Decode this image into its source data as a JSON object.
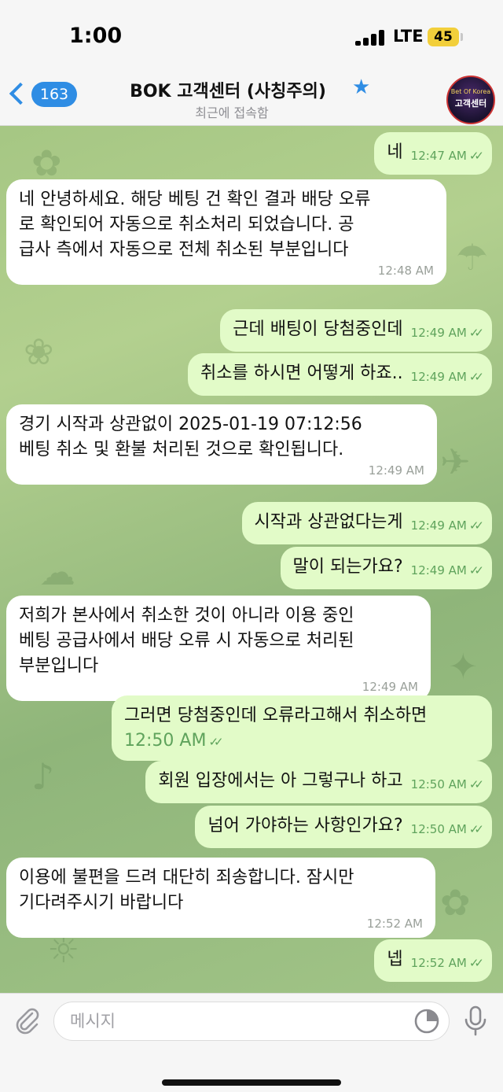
{
  "status_bar": {
    "time": "1:00",
    "network": "LTE",
    "battery": "45"
  },
  "header": {
    "back_count": "163",
    "title": "BOK 고객센터 (사칭주의)",
    "subtitle": "최근에 접속함",
    "avatar_text_top": "Bet Of Korea",
    "avatar_text_main": "고객센터"
  },
  "messages": [
    {
      "dir": "out",
      "text": "네",
      "time": "12:47 AM"
    },
    {
      "dir": "in",
      "text": "네 안녕하세요. 해당 베팅 건 확인 결과 배당 오류\n로 확인되어 자동으로 취소처리 되었습니다. 공\n급사 측에서 자동으로 전체 취소된 부분입니다",
      "time": "12:48 AM"
    },
    {
      "dir": "out",
      "text": "근데 배팅이 당첨중인데",
      "time": "12:49 AM"
    },
    {
      "dir": "out",
      "text": "취소를 하시면 어떻게 하죠..",
      "time": "12:49 AM"
    },
    {
      "dir": "in",
      "text": "경기 시작과 상관없이 2025-01-19 07:12:56\n베팅 취소 및 환불 처리된 것으로 확인됩니다.",
      "time": "12:49 AM"
    },
    {
      "dir": "out",
      "text": "시작과 상관없다는게",
      "time": "12:49 AM"
    },
    {
      "dir": "out",
      "text": "말이 되는가요?",
      "time": "12:49 AM"
    },
    {
      "dir": "in",
      "text": "저희가 본사에서 취소한 것이 아니라 이용 중인\n베팅 공급사에서 배당 오류 시 자동으로 처리된\n부분입니다",
      "time": "12:49 AM"
    },
    {
      "dir": "out",
      "text": "그러면 당첨중인데 오류라고해서 취소하면",
      "time": "12:50 AM"
    },
    {
      "dir": "out",
      "text": "회원 입장에서는 아 그렇구나 하고",
      "time": "12:50 AM"
    },
    {
      "dir": "out",
      "text": "넘어 가야하는 사항인가요?",
      "time": "12:50 AM"
    },
    {
      "dir": "in",
      "text": "이용에 불편을 드려 대단히 죄송합니다. 잠시만\n기다려주시기 바랍니다",
      "time": "12:52 AM"
    },
    {
      "dir": "out",
      "text": "넵",
      "time": "12:52 AM"
    }
  ],
  "input": {
    "placeholder": "메시지",
    "value": ""
  },
  "icons": {
    "attach": "paperclip-icon",
    "sticker": "sticker-icon",
    "mic": "microphone-icon",
    "back": "chevron-left-icon",
    "star": "star-icon",
    "read": "double-check-icon"
  },
  "colors": {
    "accent": "#2f8de4",
    "outgoing_bubble": "#e2fbc8",
    "incoming_bubble": "#ffffff",
    "outgoing_meta": "#5fa35c"
  }
}
